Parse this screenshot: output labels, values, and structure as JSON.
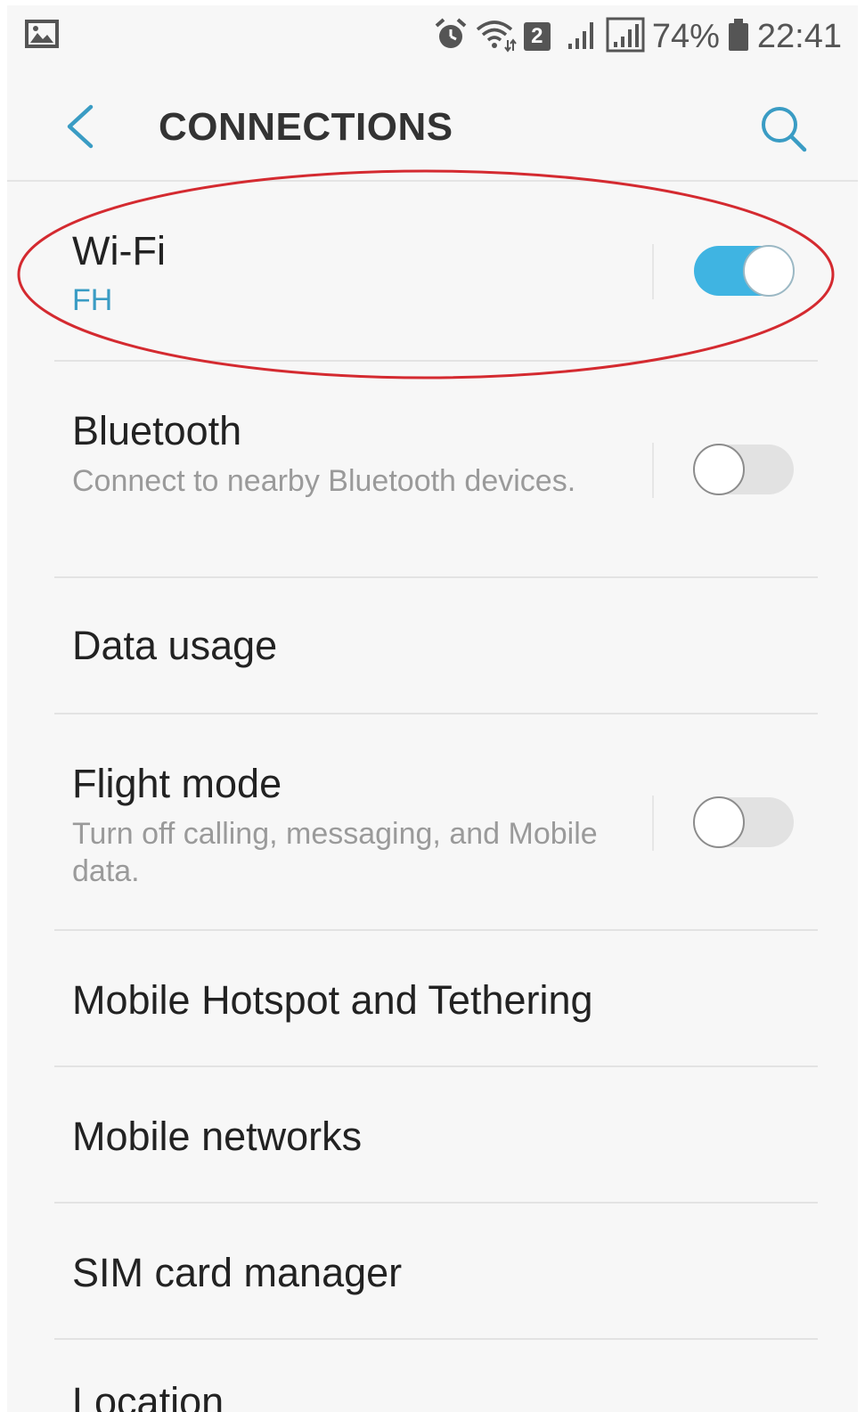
{
  "status_bar": {
    "battery_percent": "74%",
    "time": "22:41",
    "notification_badge": "2",
    "icons": [
      "gallery-icon",
      "alarm-icon",
      "wifi-icon",
      "sim-badge-icon",
      "signal-icon",
      "signal-icon",
      "battery-icon"
    ]
  },
  "header": {
    "title": "CONNECTIONS",
    "back_icon": "chevron-left-icon",
    "search_icon": "search-icon"
  },
  "items": [
    {
      "title": "Wi-Fi",
      "subtitle": "FH",
      "toggle": true,
      "toggle_on": true
    },
    {
      "title": "Bluetooth",
      "subtitle": "Connect to nearby Bluetooth devices.",
      "toggle": true,
      "toggle_on": false
    },
    {
      "title": "Data usage"
    },
    {
      "title": "Flight mode",
      "subtitle": "Turn off calling, messaging, and Mobile data.",
      "toggle": true,
      "toggle_on": false
    },
    {
      "title": "Mobile Hotspot and Tethering"
    },
    {
      "title": "Mobile networks"
    },
    {
      "title": "SIM card manager"
    },
    {
      "title": "Location"
    }
  ],
  "colors": {
    "accent": "#3fb4e2",
    "accent_text": "#3a9cc4",
    "highlight_ring": "#d42a30",
    "background": "#f7f7f7"
  }
}
